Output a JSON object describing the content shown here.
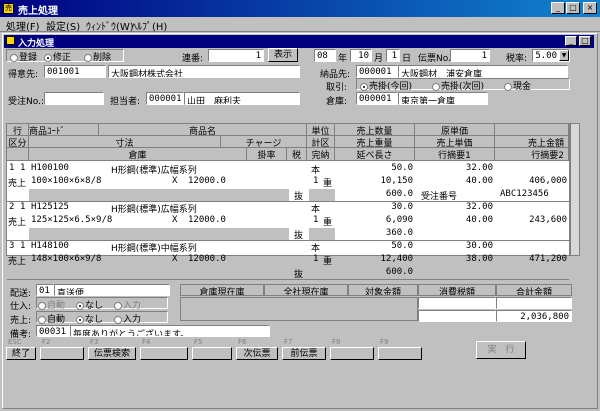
{
  "window": {
    "title": "売上処理",
    "icon": "app-icon"
  },
  "menu": [
    "処理(F)",
    "設定(S)",
    "ｳｨﾝﾄﾞｳ(W)",
    "ﾍﾙﾌﾟ(H)"
  ],
  "child": {
    "title": "入力処理"
  },
  "mode": {
    "options": [
      "登録",
      "修正",
      "削除"
    ],
    "selected": 1
  },
  "serial": {
    "label": "連番:",
    "value": "1",
    "show_btn": "表示"
  },
  "date": {
    "era": "08",
    "year_unit": "年",
    "month": "10",
    "month_unit": "月",
    "day": "1",
    "day_unit": "日"
  },
  "voucher": {
    "label": "伝票No.",
    "value": "1"
  },
  "tax_rate": {
    "label": "税率:",
    "value": "5.00"
  },
  "customer": {
    "label": "得意先:",
    "code": "001001",
    "name": "大阪鋼材株式会社"
  },
  "delivery": {
    "label": "納品先:",
    "code": "000001",
    "name": "大阪鋼材　浦安倉庫"
  },
  "torihiki": {
    "label": "取引:",
    "options": [
      "売掛(今回)",
      "売掛(次回)",
      "現金"
    ],
    "selected": 0
  },
  "order_no": {
    "label": "受注No.:",
    "value": ""
  },
  "staff": {
    "label": "担当者:",
    "code": "000001",
    "name": "山田　麻利夫"
  },
  "warehouse": {
    "label": "倉庫:",
    "code": "000001",
    "name": "東京第一倉庫"
  },
  "grid_headers": {
    "r1": [
      "行",
      "商品ｺｰﾄﾞ",
      "商品名",
      "単位",
      "売上数量",
      "原単価",
      ""
    ],
    "r2": [
      "区分",
      "寸法",
      "チャージ",
      "計区",
      "売上重量",
      "売上単価",
      "売上金額"
    ],
    "r3": [
      "倉庫",
      "掛率",
      "税",
      "完納",
      "延べ長さ",
      "行摘要1",
      "行摘要2"
    ]
  },
  "rows": [
    {
      "line": "1",
      "kubun": "1",
      "type": "売上",
      "code": "H100100",
      "name": "H形鋼(標準)広幅系列",
      "size": "100×100×6×8/8",
      "x": "X",
      "length": "12000.0",
      "unit": "本",
      "calc": "1",
      "jyu": "重",
      "qty": "50.0",
      "cost": "32.00",
      "weight": "10,150",
      "price": "40.00",
      "amount": "406,000",
      "nuki": "抜",
      "nobe": "600.0",
      "memo1": "受注番号",
      "memo2": "ABC123456"
    },
    {
      "line": "2",
      "kubun": "1",
      "type": "売上",
      "code": "H125125",
      "name": "H形鋼(標準)広幅系列",
      "size": "125×125×6.5×9/8",
      "x": "X",
      "length": "12000.0",
      "unit": "本",
      "calc": "1",
      "jyu": "重",
      "qty": "30.0",
      "cost": "32.00",
      "weight": "6,090",
      "price": "40.00",
      "amount": "243,600",
      "nuki": "抜",
      "nobe": "360.0",
      "memo1": "",
      "memo2": ""
    },
    {
      "line": "3",
      "kubun": "1",
      "type": "売上",
      "code": "H148100",
      "name": "H形鋼(標準)中幅系列",
      "size": "148×100×6×9/8",
      "x": "X",
      "length": "12000.0",
      "unit": "本",
      "calc": "1",
      "jyu": "重",
      "qty": "50.0",
      "cost": "30.00",
      "weight": "12,400",
      "price": "38.00",
      "amount": "471,200",
      "nuki": "抜",
      "nobe": "600.0",
      "memo1": "",
      "memo2": ""
    }
  ],
  "haiso": {
    "label": "配送:",
    "code": "01",
    "name": "直送便"
  },
  "shiire": {
    "label": "仕入:",
    "options": [
      "自動",
      "なし",
      "入力"
    ],
    "selected": 1
  },
  "uriage": {
    "label": "売上:",
    "options": [
      "自動",
      "なし",
      "入力"
    ],
    "selected": 1
  },
  "biko": {
    "label": "備考:",
    "code": "00031",
    "text": "毎度ありがとうございます。"
  },
  "summary": {
    "headers": [
      "倉庫現在庫",
      "全社現在庫",
      "対象金額",
      "消費税額",
      "合計金額"
    ],
    "total": "2,036,800"
  },
  "fkeys": [
    {
      "key": "ESC",
      "label": "終了"
    },
    {
      "key": "F2",
      "label": ""
    },
    {
      "key": "F3",
      "label": "伝票検索"
    },
    {
      "key": "F4",
      "label": ""
    },
    {
      "key": "F5",
      "label": ""
    },
    {
      "key": "F6",
      "label": "次伝票"
    },
    {
      "key": "F7",
      "label": "前伝票"
    },
    {
      "key": "F8",
      "label": ""
    },
    {
      "key": "F9",
      "label": ""
    }
  ],
  "exec_btn": "実　行"
}
